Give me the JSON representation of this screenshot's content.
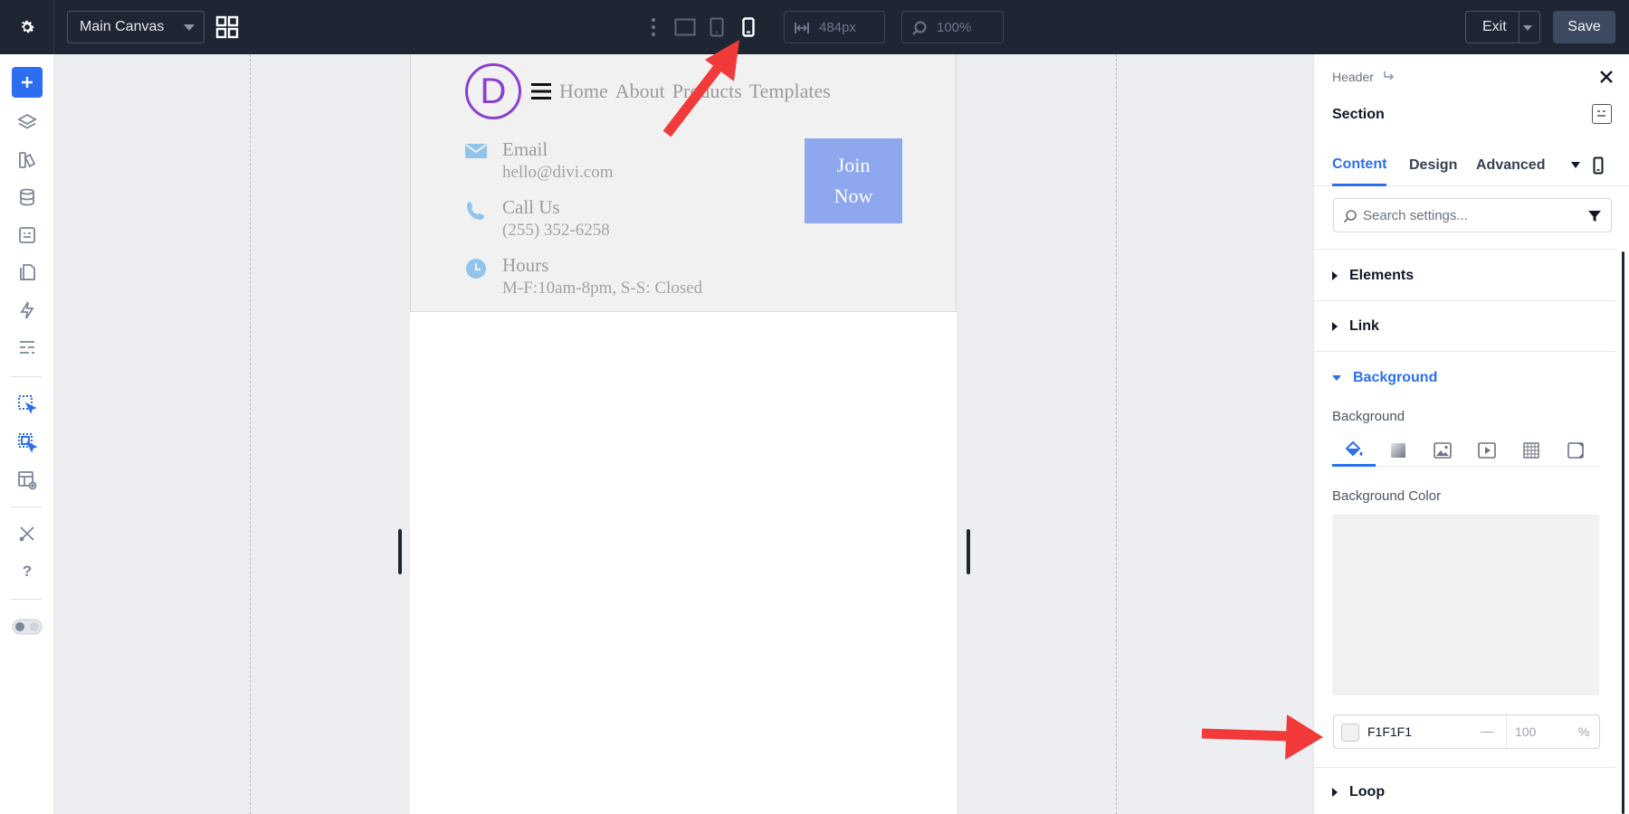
{
  "topbar": {
    "canvas_select": "Main Canvas",
    "width_value": "484px",
    "zoom_value": "100%",
    "exit_label": "Exit",
    "save_label": "Save"
  },
  "page": {
    "logo_letter": "D",
    "menu": [
      "Home",
      "About",
      "Products",
      "Templates"
    ],
    "contacts": [
      {
        "label": "Email",
        "value": "hello@divi.com",
        "icon": "envelope-icon"
      },
      {
        "label": "Call Us",
        "value": "(255) 352-6258",
        "icon": "phone-icon"
      },
      {
        "label": "Hours",
        "value": "M-F:10am-8pm, S-S: Closed",
        "icon": "clock-icon"
      }
    ],
    "join_line1": "Join",
    "join_line2": "Now"
  },
  "panel": {
    "breadcrumb": "Header",
    "title": "Section",
    "tabs": [
      "Content",
      "Design",
      "Advanced"
    ],
    "search_placeholder": "Search settings...",
    "groups": {
      "elements": "Elements",
      "link": "Link",
      "background": "Background",
      "loop": "Loop"
    },
    "background_label": "Background",
    "background_color_label": "Background Color",
    "color_hex": "F1F1F1",
    "color_dash": "—",
    "opacity": "100",
    "opacity_unit": "%"
  },
  "colors": {
    "accent": "#2b6ff0",
    "topbar": "#1e2634",
    "logo": "#8b3fd0",
    "button": "#8fa7ef",
    "header_bg": "#f1f1f1",
    "annotation_arrow": "#f23a3a"
  }
}
